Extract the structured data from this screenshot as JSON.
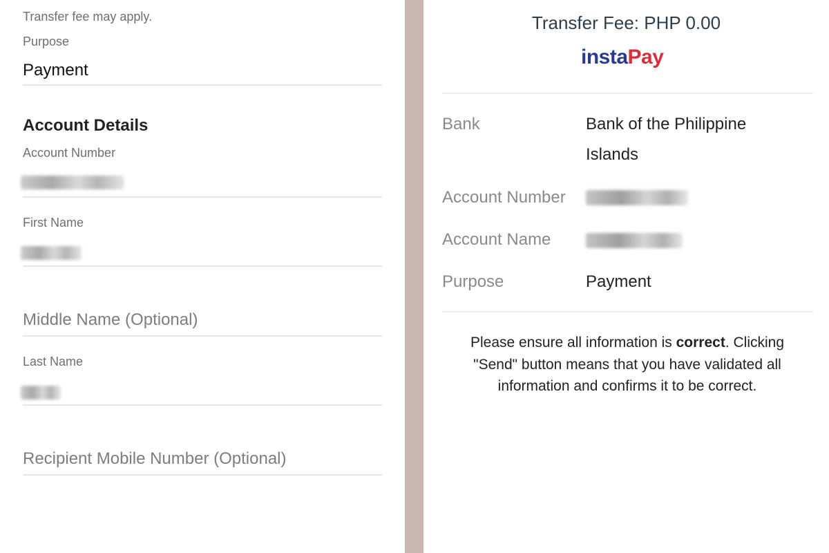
{
  "form": {
    "transfer_note": "Transfer fee may apply.",
    "purpose_label": "Purpose",
    "purpose_value": "Payment",
    "account_details_title": "Account Details",
    "account_number_label": "Account Number",
    "first_name_label": "First Name",
    "middle_name_placeholder": "Middle Name (Optional)",
    "last_name_label": "Last Name",
    "mobile_placeholder": "Recipient Mobile Number (Optional)"
  },
  "summary": {
    "transfer_fee": "Transfer Fee: PHP 0.00",
    "logo_insta": "insta",
    "logo_pay": "Pay",
    "bank_label": "Bank",
    "bank_value": "Bank of the Philippine Islands",
    "account_number_label": "Account Number",
    "account_name_label": "Account Name",
    "purpose_label": "Purpose",
    "purpose_value": "Payment",
    "disclaimer_pre": "Please ensure all information is ",
    "disclaimer_bold": "correct",
    "disclaimer_post": ". Clicking \"Send\" button means that you have validated all information and confirms it to be correct."
  },
  "colors": {
    "divider": "#c9b8b2",
    "instapay_blue": "#2d3a8c",
    "instapay_red": "#d62f3a"
  }
}
